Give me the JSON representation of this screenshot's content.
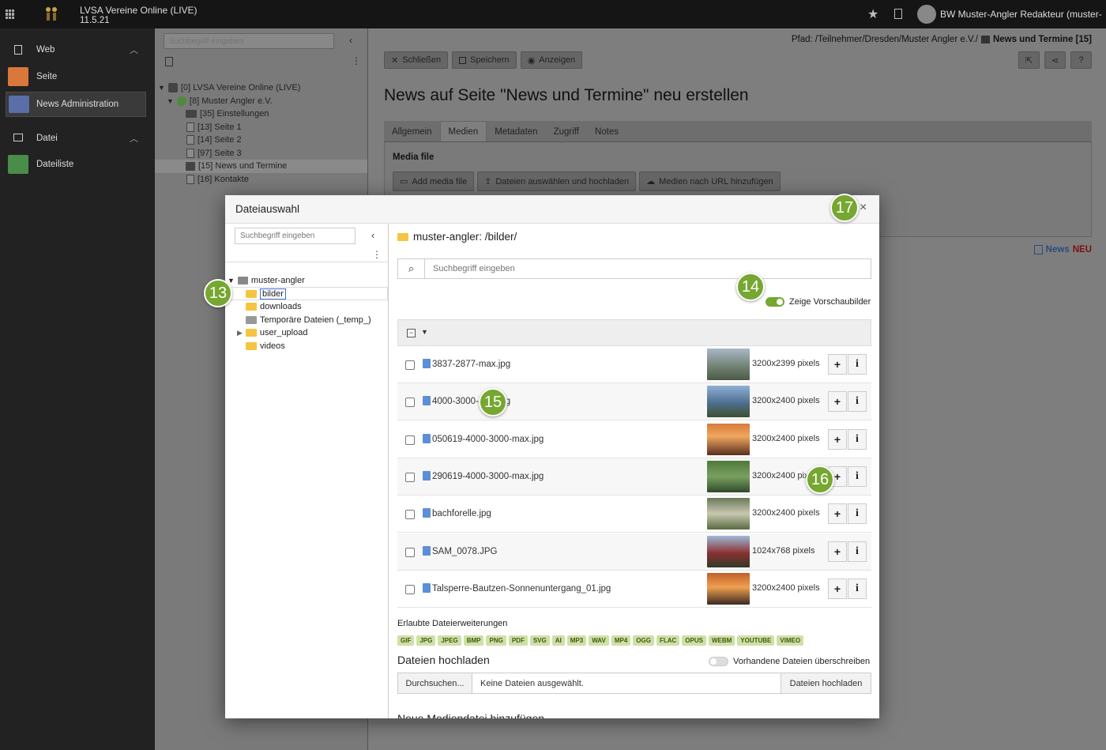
{
  "topbar": {
    "app_title": "LVSA Vereine Online (LIVE)",
    "version": "11.5.21",
    "user_name": "BW Muster-Angler Redakteur (muster-"
  },
  "sidebar": {
    "groups": [
      {
        "label": "Web",
        "items": [
          "Seite",
          "News Administration"
        ]
      },
      {
        "label": "Datei",
        "items": [
          "Dateiliste"
        ]
      }
    ]
  },
  "page_tree": {
    "search_placeholder": "Suchbegriff eingeben",
    "nodes": [
      "[0] LVSA Vereine Online (LIVE)",
      "[8] Muster Angler e.V.",
      "[35] Einstellungen",
      "[13] Seite 1",
      "[14] Seite 2",
      "[97] Seite 3",
      "[15] News und Termine",
      "[16] Kontakte"
    ]
  },
  "content": {
    "path_label": "Pfad: /Teilnehmer/Dresden/Muster Angler e.V./",
    "path_page": "News und Termine [15]",
    "toolbar": {
      "close": "Schließen",
      "save": "Speichern",
      "view": "Anzeigen"
    },
    "title": "News auf Seite \"News und Termine\" neu erstellen",
    "tabs": [
      "Allgemein",
      "Medien",
      "Metadaten",
      "Zugriff",
      "Notes"
    ],
    "active_tab": "Medien",
    "media_file_label": "Media file",
    "media_buttons": {
      "add": "Add media file",
      "upload": "Dateien auswählen und hochladen",
      "url": "Medien nach URL hinzufügen"
    },
    "news_label": "News",
    "neu_label": "NEU"
  },
  "modal": {
    "title": "Dateiauswahl",
    "close": "×",
    "tree_search_placeholder": "Suchbegriff eingeben",
    "tree": {
      "root": "muster-angler",
      "folders": [
        "bilder",
        "downloads",
        "Temporäre Dateien (_temp_)",
        "user_upload",
        "videos"
      ]
    },
    "path": "muster-angler: /bilder/",
    "search_placeholder": "Suchbegriff eingeben",
    "thumbnail_toggle_label": "Zeige Vorschaubilder",
    "files": [
      {
        "name": "3837-2877-max.jpg",
        "dims": "3200x2399 pixels"
      },
      {
        "name": "4000-3000-max.jpg",
        "dims": "3200x2400 pixels"
      },
      {
        "name": "050619-4000-3000-max.jpg",
        "dims": "3200x2400 pixels"
      },
      {
        "name": "290619-4000-3000-max.jpg",
        "dims": "3200x2400 pixels"
      },
      {
        "name": "bachforelle.jpg",
        "dims": "3200x2400 pixels"
      },
      {
        "name": "SAM_0078.JPG",
        "dims": "1024x768 pixels"
      },
      {
        "name": "Talsperre-Bautzen-Sonnenuntergang_01.jpg",
        "dims": "3200x2400 pixels"
      }
    ],
    "allowed_label": "Erlaubte Dateierweiterungen",
    "extensions": [
      "GIF",
      "JPG",
      "JPEG",
      "BMP",
      "PNG",
      "PDF",
      "SVG",
      "AI",
      "MP3",
      "WAV",
      "MP4",
      "OGG",
      "FLAC",
      "OPUS",
      "WEBM",
      "YOUTUBE",
      "VIMEO"
    ],
    "upload_title": "Dateien hochladen",
    "overwrite_label": "Vorhandene Dateien überschreiben",
    "browse": "Durchsuchen...",
    "no_files": "Keine Dateien ausgewählt.",
    "upload_button": "Dateien hochladen",
    "cut_heading": "Neue Mediendatei hinzufügen"
  },
  "callouts": [
    "13",
    "14",
    "15",
    "16",
    "17"
  ],
  "colors": {
    "accent_green": "#76a730",
    "topbar": "#151515",
    "sidebar": "#222222"
  }
}
